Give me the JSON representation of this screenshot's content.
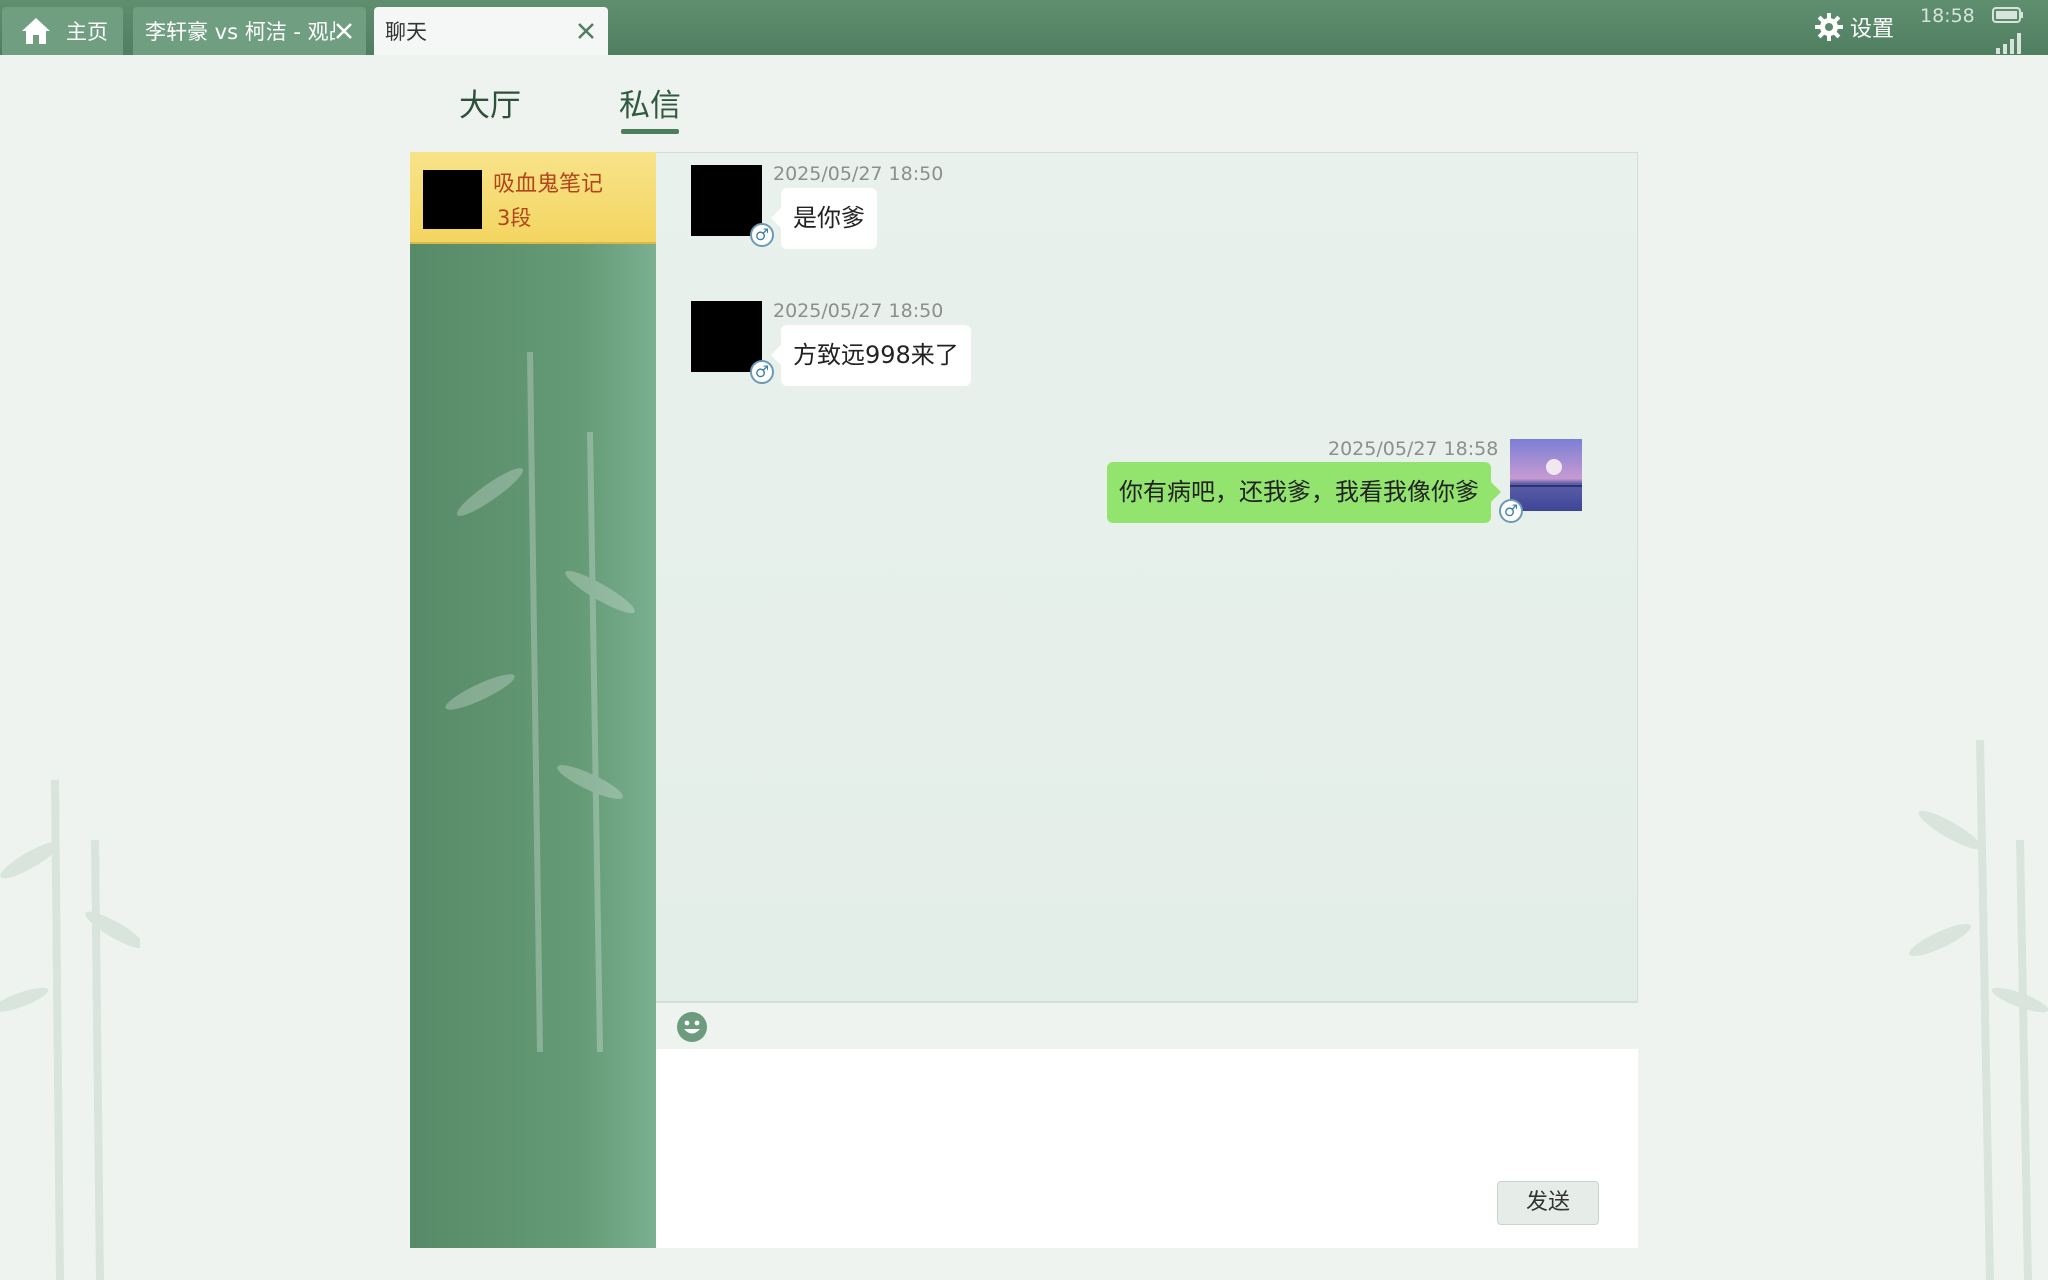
{
  "tabs": [
    {
      "label": "主页"
    },
    {
      "label": "李轩豪 vs 柯洁 - 观战"
    },
    {
      "label": "聊天"
    }
  ],
  "status": {
    "settings_label": "设置",
    "time": "18:58"
  },
  "segments": {
    "hall": "大厅",
    "private": "私信"
  },
  "contact": {
    "name": "吸血鬼笔记",
    "rank": "3段"
  },
  "messages": [
    {
      "time": "2025/05/27 18:50",
      "text": "是你爹",
      "from": "other"
    },
    {
      "time": "2025/05/27 18:50",
      "text": "方致远998来了",
      "from": "other"
    },
    {
      "time": "2025/05/27 18:58",
      "text": "你有病吧，还我爹，我看我像你爹",
      "from": "me"
    }
  ],
  "gender_symbol": "♂",
  "input": {
    "send_label": "发送"
  },
  "colors": {
    "accent": "#4f7f60",
    "my_bubble": "#93e46e",
    "selected_contact": "#f3d560",
    "contact_text": "#b3451b"
  }
}
